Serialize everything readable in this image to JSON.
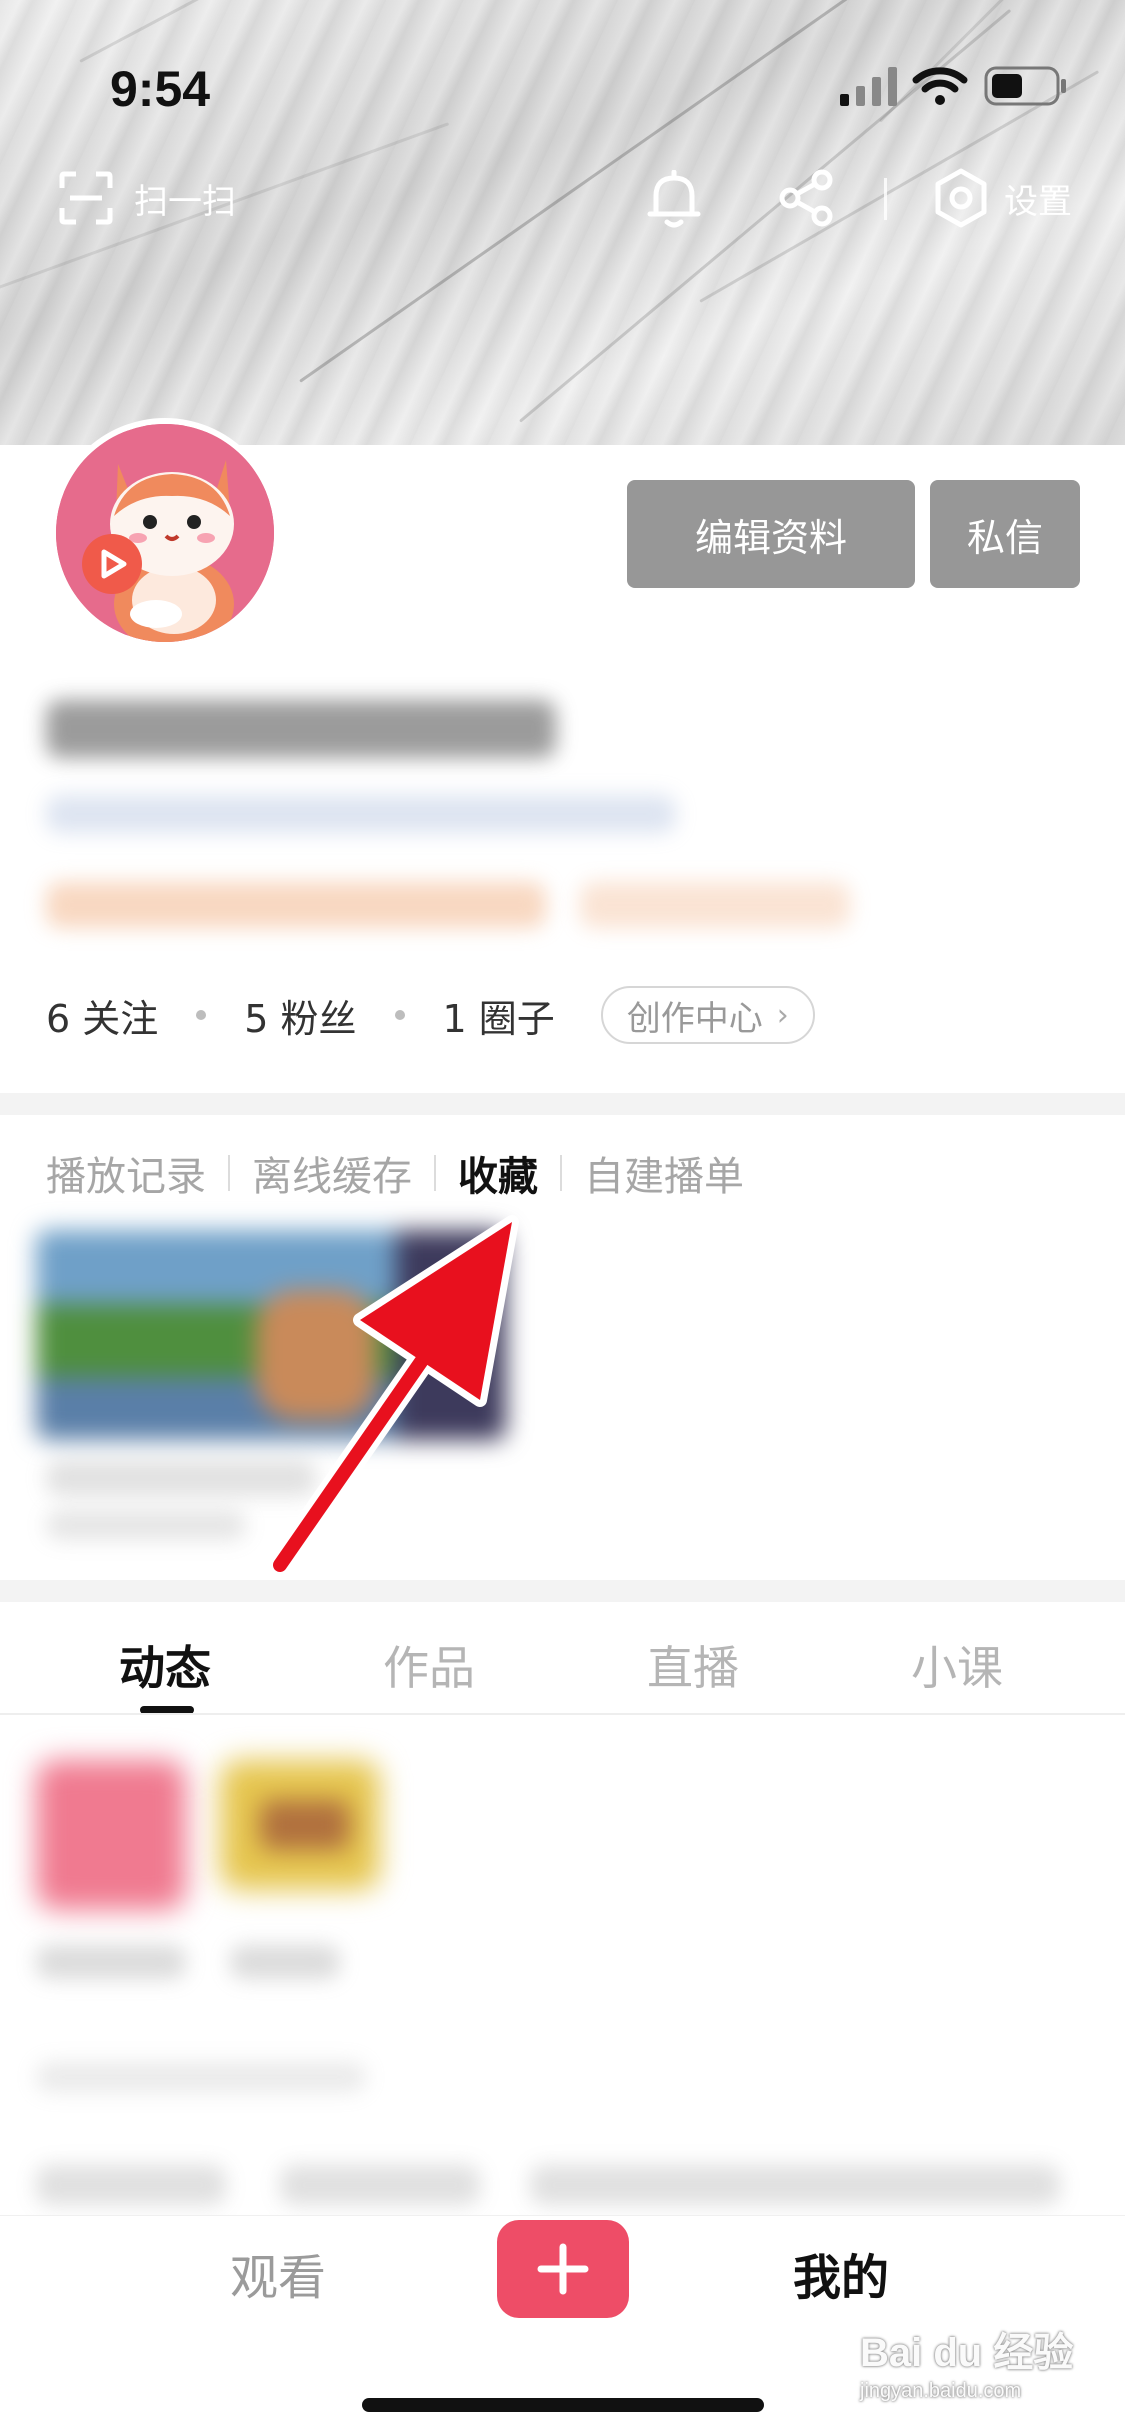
{
  "status_bar": {
    "time": "9:54"
  },
  "header": {
    "scan_label": "扫一扫",
    "settings_label": "设置"
  },
  "profile": {
    "edit_profile": "编辑资料",
    "private_message": "私信"
  },
  "stats": {
    "following": "6 关注",
    "fans": "5 粉丝",
    "circles": "1 圈子",
    "creator_center": "创作中心"
  },
  "library_tabs": {
    "history": "播放记录",
    "offline": "离线缓存",
    "favorites": "收藏",
    "playlists": "自建播单"
  },
  "content_tabs": {
    "feed": "动态",
    "works": "作品",
    "live": "直播",
    "courses": "小课"
  },
  "bottom_nav": {
    "watch": "观看",
    "mine": "我的"
  },
  "watermark": {
    "brand": "Bai du 经验",
    "url": "jingyan.baidu.com"
  },
  "colors": {
    "annotation_arrow": "#e8101e",
    "add_button": "#ee4d67",
    "gray_button": "#979797"
  }
}
